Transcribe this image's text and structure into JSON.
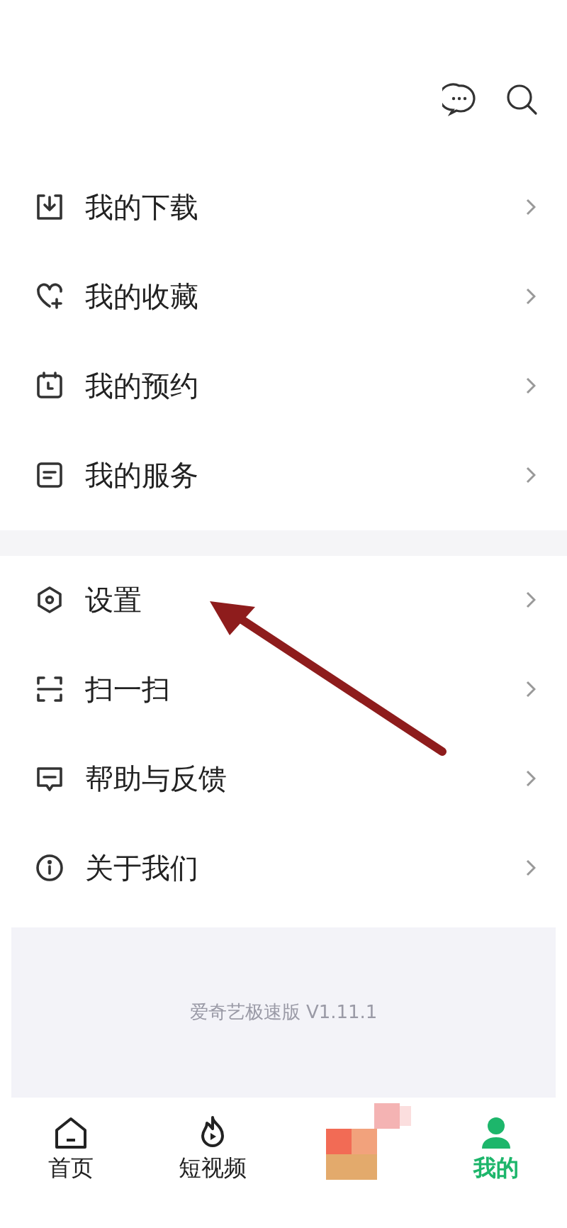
{
  "menu_groups": [
    {
      "items": [
        {
          "label": "我的下载"
        },
        {
          "label": "我的收藏"
        },
        {
          "label": "我的预约"
        },
        {
          "label": "我的服务"
        }
      ]
    },
    {
      "items": [
        {
          "label": "设置"
        },
        {
          "label": "扫一扫"
        },
        {
          "label": "帮助与反馈"
        },
        {
          "label": "关于我们"
        }
      ]
    }
  ],
  "version": "爱奇艺极速版 V1.11.1",
  "bottom_nav": [
    {
      "kind": "tab",
      "label": "首页",
      "selected": false
    },
    {
      "kind": "tab",
      "label": "短视频",
      "selected": false
    },
    {
      "kind": "picture"
    },
    {
      "kind": "tab",
      "label": "我的",
      "selected": true
    }
  ]
}
